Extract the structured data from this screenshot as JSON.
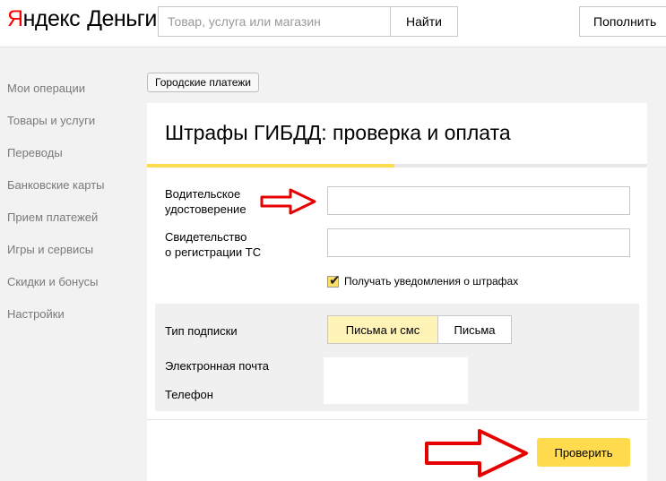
{
  "header": {
    "logo_main": "Яндекс",
    "logo_first": "Я",
    "logo_rest": "ндекс",
    "logo_sub": "Деньги",
    "search_placeholder": "Товар, услуга или магазин",
    "search_button": "Найти",
    "topup_button": "Пополнить"
  },
  "sidebar": {
    "items": [
      {
        "label": "Мои операции"
      },
      {
        "label": "Товары и услуги"
      },
      {
        "label": "Переводы"
      },
      {
        "label": "Банковские карты"
      },
      {
        "label": "Прием платежей"
      },
      {
        "label": "Игры и сервисы"
      },
      {
        "label": "Скидки и бонусы"
      },
      {
        "label": "Настройки"
      }
    ]
  },
  "breadcrumb": "Городские платежи",
  "form": {
    "title": "Штрафы ГИБДД: проверка и оплата",
    "progress_fraction": 0.495,
    "progress_color": "#ffdb4d",
    "license_label_line1": "Водительское",
    "license_label_line2": "удостоверение",
    "license_value": "",
    "registration_label_line1": "Свидетельство",
    "registration_label_line2": "о регистрации ТС",
    "registration_value": "",
    "notify_label": "Получать уведомления о штрафах",
    "notify_checked": true,
    "subscription_label": "Тип подписки",
    "subscription_options": [
      "Письма и смс",
      "Письма"
    ],
    "subscription_selected": "Письма и смс",
    "email_label": "Электронная почта",
    "phone_label": "Телефон",
    "submit_button": "Проверить"
  },
  "colors": {
    "accent": "#ffdb4d",
    "logo_red": "#ff0000",
    "annotation_arrow": "#e60000"
  },
  "icons": [
    "checkmark-icon",
    "red-arrow-icon"
  ]
}
